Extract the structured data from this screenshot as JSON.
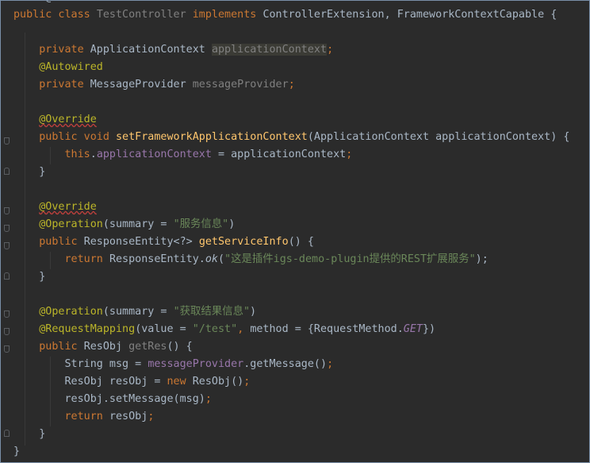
{
  "editor": {
    "partial_top_text": "  t  @  f  ",
    "lines": [
      [
        {
          "t": "public class ",
          "c": "kw"
        },
        {
          "t": "TestController ",
          "c": "unused"
        },
        {
          "t": "implements ",
          "c": "kw"
        },
        {
          "t": "ControllerExtension, FrameworkContextCapable {",
          "c": ""
        }
      ],
      [],
      [
        {
          "t": "    ",
          "c": ""
        },
        {
          "t": "private ",
          "c": "kw"
        },
        {
          "t": "ApplicationContext ",
          "c": ""
        },
        {
          "t": "applicationContext",
          "c": "unused hl"
        },
        {
          "t": ";",
          "c": "kw"
        }
      ],
      [
        {
          "t": "    ",
          "c": ""
        },
        {
          "t": "@Autowired",
          "c": "ann"
        }
      ],
      [
        {
          "t": "    ",
          "c": ""
        },
        {
          "t": "private ",
          "c": "kw"
        },
        {
          "t": "MessageProvider ",
          "c": ""
        },
        {
          "t": "messageProvider",
          "c": "unused"
        },
        {
          "t": ";",
          "c": "kw"
        }
      ],
      [],
      [
        {
          "t": "    ",
          "c": ""
        },
        {
          "t": "@Override",
          "c": "ann wavy"
        }
      ],
      [
        {
          "t": "    ",
          "c": ""
        },
        {
          "t": "public void ",
          "c": "kw"
        },
        {
          "t": "setFrameworkApplicationContext",
          "c": "fn"
        },
        {
          "t": "(ApplicationContext applicationContext) {",
          "c": ""
        }
      ],
      [
        {
          "t": "        ",
          "c": ""
        },
        {
          "t": "this",
          "c": "kw"
        },
        {
          "t": ".",
          "c": ""
        },
        {
          "t": "applicationContext",
          "c": "fld"
        },
        {
          "t": " = applicationContext",
          "c": ""
        },
        {
          "t": ";",
          "c": "kw"
        }
      ],
      [
        {
          "t": "    }",
          "c": ""
        }
      ],
      [],
      [
        {
          "t": "    ",
          "c": ""
        },
        {
          "t": "@Override",
          "c": "ann wavy"
        }
      ],
      [
        {
          "t": "    ",
          "c": ""
        },
        {
          "t": "@Operation",
          "c": "ann"
        },
        {
          "t": "(summary = ",
          "c": ""
        },
        {
          "t": "\"服务信息\"",
          "c": "str"
        },
        {
          "t": ")",
          "c": ""
        }
      ],
      [
        {
          "t": "    ",
          "c": ""
        },
        {
          "t": "public ",
          "c": "kw"
        },
        {
          "t": "ResponseEntity<?> ",
          "c": ""
        },
        {
          "t": "getServiceInfo",
          "c": "fn"
        },
        {
          "t": "() {",
          "c": ""
        }
      ],
      [
        {
          "t": "        ",
          "c": ""
        },
        {
          "t": "return ",
          "c": "kw"
        },
        {
          "t": "ResponseEntity.",
          "c": ""
        },
        {
          "t": "ok",
          "c": "ital"
        },
        {
          "t": "(",
          "c": ""
        },
        {
          "t": "\"这是插件igs-demo-plugin提供的REST扩展服务\"",
          "c": "str"
        },
        {
          "t": ");",
          "c": ""
        }
      ],
      [
        {
          "t": "    }",
          "c": ""
        }
      ],
      [],
      [
        {
          "t": "    ",
          "c": ""
        },
        {
          "t": "@Operation",
          "c": "ann"
        },
        {
          "t": "(summary = ",
          "c": ""
        },
        {
          "t": "\"获取结果信息\"",
          "c": "str"
        },
        {
          "t": ")",
          "c": ""
        }
      ],
      [
        {
          "t": "    ",
          "c": ""
        },
        {
          "t": "@RequestMapping",
          "c": "ann"
        },
        {
          "t": "(value = ",
          "c": ""
        },
        {
          "t": "\"/test\"",
          "c": "str"
        },
        {
          "t": ", ",
          "c": "kw"
        },
        {
          "t": "method = {RequestMethod.",
          "c": ""
        },
        {
          "t": "GET",
          "c": "fld ital"
        },
        {
          "t": "})",
          "c": ""
        }
      ],
      [
        {
          "t": "    ",
          "c": ""
        },
        {
          "t": "public ",
          "c": "kw"
        },
        {
          "t": "ResObj ",
          "c": ""
        },
        {
          "t": "getRes",
          "c": "unused"
        },
        {
          "t": "() {",
          "c": ""
        }
      ],
      [
        {
          "t": "        String msg = ",
          "c": ""
        },
        {
          "t": "messageProvider",
          "c": "fld"
        },
        {
          "t": ".getMessage()",
          "c": ""
        },
        {
          "t": ";",
          "c": "kw"
        }
      ],
      [
        {
          "t": "        ResObj resObj = ",
          "c": ""
        },
        {
          "t": "new ",
          "c": "kw"
        },
        {
          "t": "ResObj()",
          "c": ""
        },
        {
          "t": ";",
          "c": "kw"
        }
      ],
      [
        {
          "t": "        resObj.setMessage(msg)",
          "c": ""
        },
        {
          "t": ";",
          "c": "kw"
        }
      ],
      [
        {
          "t": "        ",
          "c": ""
        },
        {
          "t": "return ",
          "c": "kw"
        },
        {
          "t": "resObj",
          "c": ""
        },
        {
          "t": ";",
          "c": "kw"
        }
      ],
      [
        {
          "t": "    }",
          "c": ""
        }
      ],
      [
        {
          "t": "}",
          "c": ""
        }
      ]
    ]
  }
}
